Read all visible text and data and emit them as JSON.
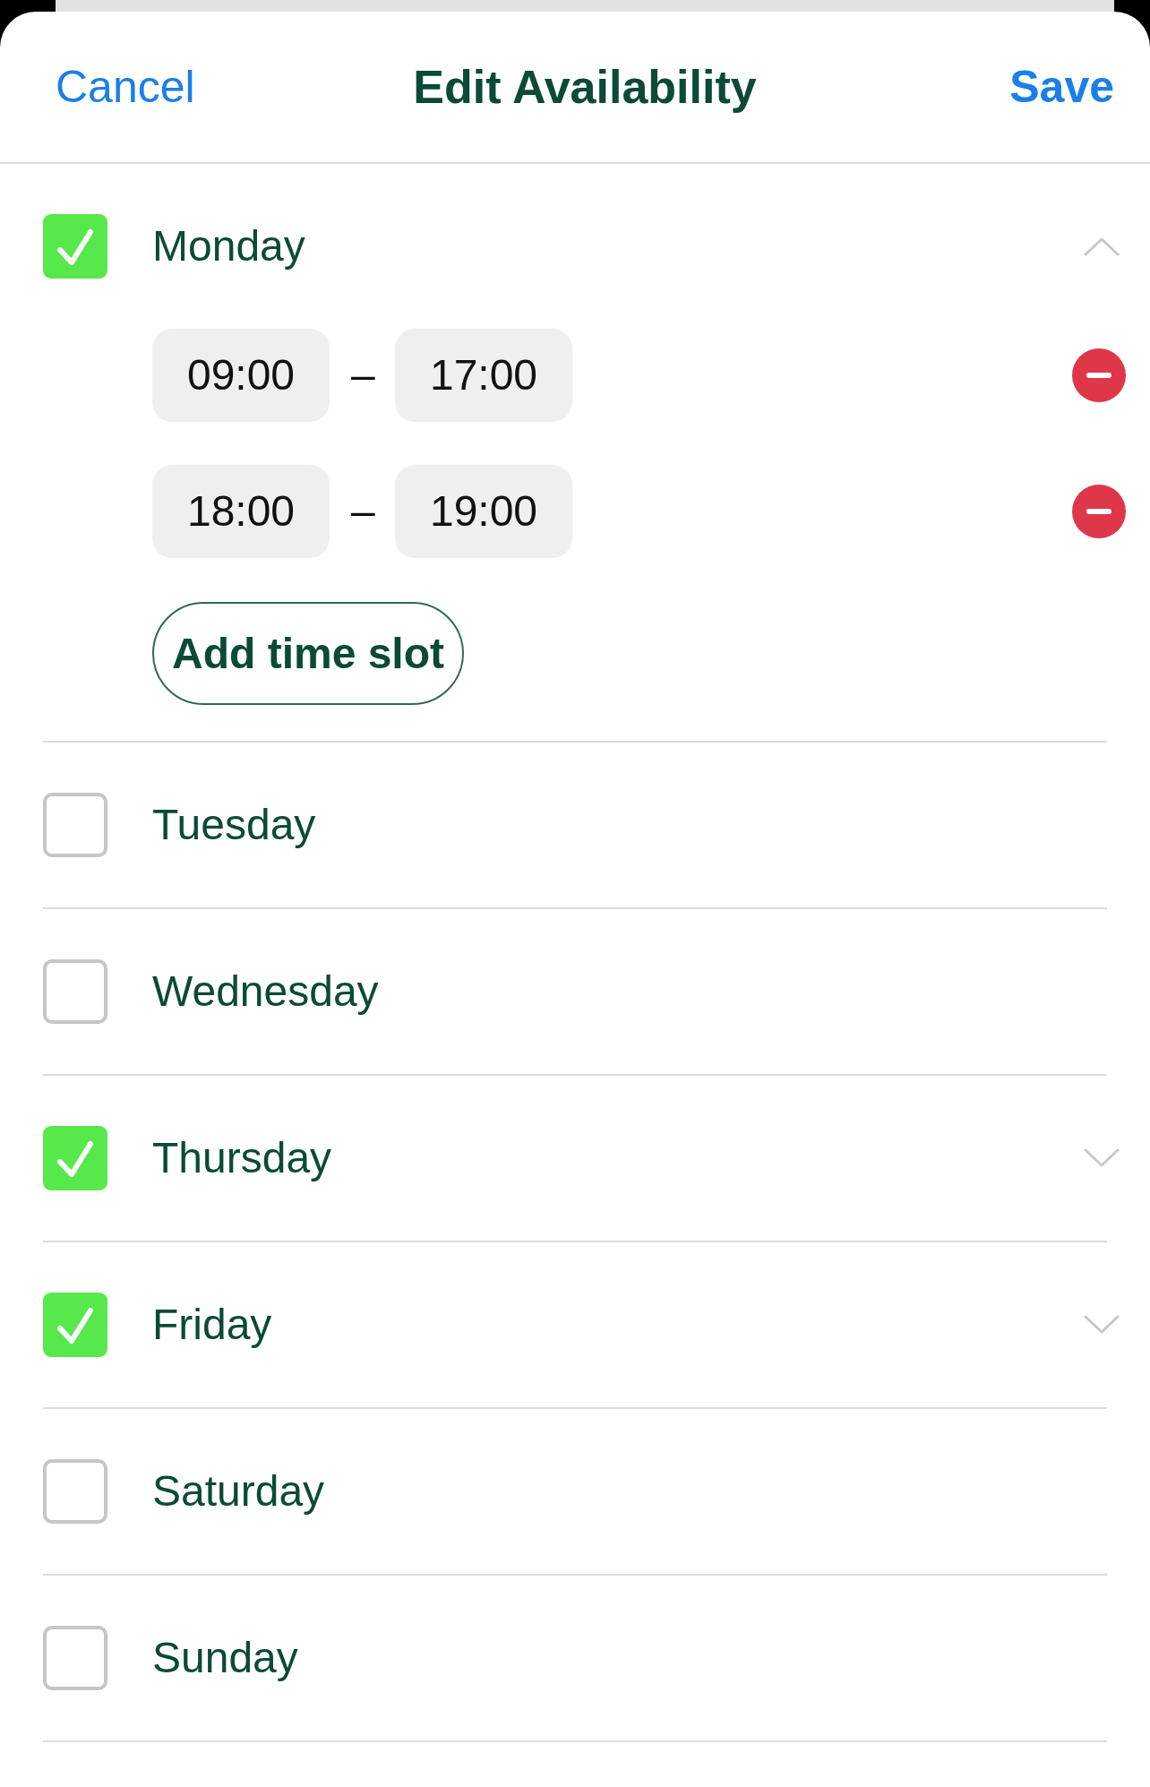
{
  "header": {
    "cancel": "Cancel",
    "title": "Edit Availability",
    "save": "Save"
  },
  "days": [
    {
      "name": "Monday",
      "checked": true,
      "expanded": true,
      "slots": [
        {
          "start": "09:00",
          "separator": "–",
          "end": "17:00"
        },
        {
          "start": "18:00",
          "separator": "–",
          "end": "19:00"
        }
      ],
      "add_button": "Add time slot"
    },
    {
      "name": "Tuesday",
      "checked": false
    },
    {
      "name": "Wednesday",
      "checked": false
    },
    {
      "name": "Thursday",
      "checked": true,
      "expanded": false
    },
    {
      "name": "Friday",
      "checked": true,
      "expanded": false
    },
    {
      "name": "Saturday",
      "checked": false
    },
    {
      "name": "Sunday",
      "checked": false
    }
  ]
}
